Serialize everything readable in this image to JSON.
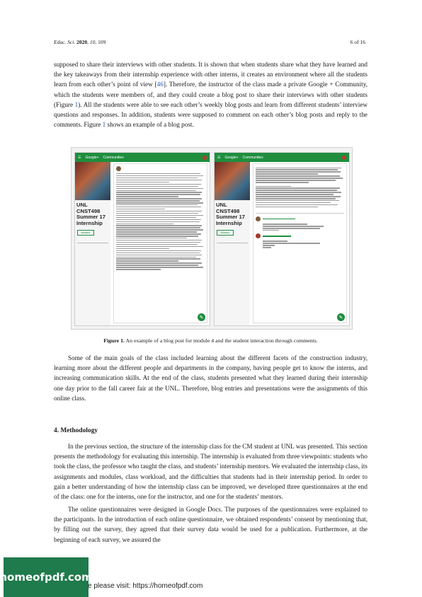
{
  "header": {
    "journal": "Educ. Sci.",
    "year": "2020",
    "volume": "10",
    "article": "109",
    "page": "6 of 16"
  },
  "p1": {
    "pre": "supposed to share their interviews with other students. It is shown that when students share what they have learned and the key takeaways from their internship experience with other interns, it creates an environment where all the students learn from each other’s point of view [",
    "ref": "46",
    "mid": "]. Therefore, the instructor of the class made a private Google + Community, which the students were members of, and they could create a blog post to share their interviews with other students (Figure ",
    "fig": "1",
    "post": "). All the students were able to see each other’s weekly blog posts and learn from different students’ interview questions and responses. In addition, students were supposed to comment on each other’s blog posts and reply to the comments. Figure ",
    "fig2": "1",
    "end": " shows an example of a blog post."
  },
  "figure": {
    "bar_brand": "Google+",
    "bar_section": "Communities",
    "community_title": "UNL CNST498 Summer 17 Internship",
    "member_label": "MEMBER",
    "fab": "✎"
  },
  "caption": {
    "label": "Figure 1.",
    "text": " An example of a blog post for module 4 and the student interaction through comments."
  },
  "p2": "Some of the main goals of the class included learning about the different facets of the construction industry, learning more about the different people and departments in the company, having people get to know the interns, and increasing communication skills. At the end of the class, students presented what they learned during their internship one day prior to the fall career fair at the UNL. Therefore, blog entries and presentations were the assignments of this online class.",
  "section_heading": "4. Methodology",
  "p3": "In the previous section, the structure of the internship class for the CM student at UNL was presented. This section presents the methodology for evaluating this internship. The internship is evaluated from three viewpoints: students who took the class, the professor who taught the class, and students’ internship mentors. We evaluated the internship class, its assignments and modules, class workload, and the difficulties that students had in their internship period. In order to gain a better understanding of how the internship class can be improved, we developed three questionnaires at the end of the class: one for the interns, one for the instructor, and one for the students’ mentors.",
  "p4": "The online questionnaires were designed in Google Docs. The purposes of the questionnaires were explained to the participants. In the introduction of each online questionnaire, we obtained respondents’ consent by mentioning that, by filling out the survey, they agreed that their survey data would be used for a publication. Furthermore, at the beginning of each survey, we assured the",
  "watermark": {
    "logo": "homeofpdf.com",
    "text": "e please visit: https://homeofpdf.com"
  },
  "colors": {
    "link": "#1a5fb4",
    "google_green": "#1e8e3e",
    "watermark_bg": "#1f7a4c"
  }
}
